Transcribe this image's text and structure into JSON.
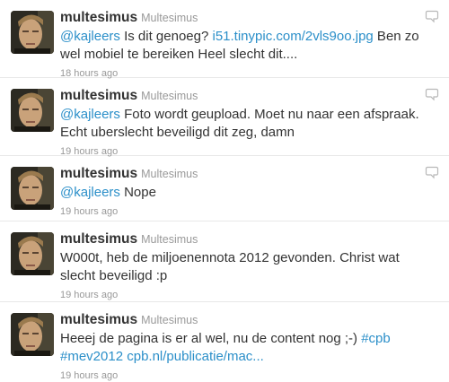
{
  "tweets": [
    {
      "fullname": "multesimus",
      "username": "Multesimus",
      "segments": [
        {
          "text": "@kajleers",
          "link": true
        },
        {
          "text": " Is dit genoeg? ",
          "link": false
        },
        {
          "text": "i51.tinypic.com/2vls9oo.jpg",
          "link": true
        },
        {
          "text": " Ben zo wel mobiel te bereiken Heel slecht dit....",
          "link": false
        }
      ],
      "time": "18 hours ago"
    },
    {
      "fullname": "multesimus",
      "username": "Multesimus",
      "segments": [
        {
          "text": "@kajleers",
          "link": true
        },
        {
          "text": " Foto wordt geupload. Moet nu naar een afspraak. Echt uberslecht beveiligd dit zeg, damn",
          "link": false
        }
      ],
      "time": "19 hours ago"
    },
    {
      "fullname": "multesimus",
      "username": "Multesimus",
      "segments": [
        {
          "text": "@kajleers",
          "link": true
        },
        {
          "text": " Nope",
          "link": false
        }
      ],
      "time": "19 hours ago"
    },
    {
      "fullname": "multesimus",
      "username": "Multesimus",
      "segments": [
        {
          "text": "W000t, heb de miljoenennota 2012 gevonden. Christ wat slecht beveiligd :p",
          "link": false
        }
      ],
      "time": "19 hours ago"
    },
    {
      "fullname": "multesimus",
      "username": "Multesimus",
      "segments": [
        {
          "text": "Heeej de pagina is er al wel, nu de content nog ;-) ",
          "link": false
        },
        {
          "text": "#cpb",
          "link": true
        },
        {
          "text": " ",
          "link": false
        },
        {
          "text": "#mev2012",
          "link": true
        },
        {
          "text": " ",
          "link": false
        },
        {
          "text": "cpb.nl/publicatie/mac...",
          "link": true
        }
      ],
      "time": "19 hours ago"
    }
  ],
  "colors": {
    "link": "#2b8fc9",
    "name": "#333333",
    "meta": "#999999",
    "divider": "#e8e8e8"
  },
  "icons": {
    "reply": "reply-icon",
    "avatar": "avatar"
  }
}
